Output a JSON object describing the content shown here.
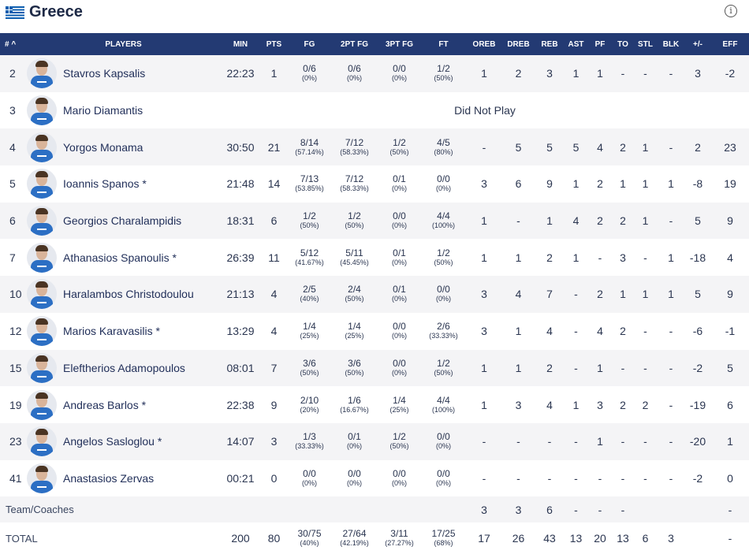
{
  "header": {
    "team_name": "Greece",
    "info_icon": "info-icon",
    "flag_icon": "greece-flag-icon"
  },
  "columns": [
    "# ^",
    "PLAYERS",
    "MIN",
    "PTS",
    "FG",
    "2PT FG",
    "3PT FG",
    "FT",
    "OREB",
    "DREB",
    "REB",
    "AST",
    "PF",
    "TO",
    "STL",
    "BLK",
    "+/-",
    "EFF"
  ],
  "players": [
    {
      "num": "2",
      "name": "Stavros Kapsalis",
      "min": "22:23",
      "pts": "1",
      "fg": "0/6",
      "fg_pct": "(0%)",
      "fg2": "0/6",
      "fg2_pct": "(0%)",
      "fg3": "0/0",
      "fg3_pct": "(0%)",
      "ft": "1/2",
      "ft_pct": "(50%)",
      "oreb": "1",
      "dreb": "2",
      "reb": "3",
      "ast": "1",
      "pf": "1",
      "to": "-",
      "stl": "-",
      "blk": "-",
      "pm": "3",
      "eff": "-2"
    },
    {
      "num": "3",
      "name": "Mario Diamantis",
      "dnp": "Did Not Play"
    },
    {
      "num": "4",
      "name": "Yorgos Monama",
      "min": "30:50",
      "pts": "21",
      "fg": "8/14",
      "fg_pct": "(57.14%)",
      "fg2": "7/12",
      "fg2_pct": "(58.33%)",
      "fg3": "1/2",
      "fg3_pct": "(50%)",
      "ft": "4/5",
      "ft_pct": "(80%)",
      "oreb": "-",
      "dreb": "5",
      "reb": "5",
      "ast": "5",
      "pf": "4",
      "to": "2",
      "stl": "1",
      "blk": "-",
      "pm": "2",
      "eff": "23"
    },
    {
      "num": "5",
      "name": "Ioannis Spanos *",
      "min": "21:48",
      "pts": "14",
      "fg": "7/13",
      "fg_pct": "(53.85%)",
      "fg2": "7/12",
      "fg2_pct": "(58.33%)",
      "fg3": "0/1",
      "fg3_pct": "(0%)",
      "ft": "0/0",
      "ft_pct": "(0%)",
      "oreb": "3",
      "dreb": "6",
      "reb": "9",
      "ast": "1",
      "pf": "2",
      "to": "1",
      "stl": "1",
      "blk": "1",
      "pm": "-8",
      "eff": "19"
    },
    {
      "num": "6",
      "name": "Georgios Charalampidis",
      "min": "18:31",
      "pts": "6",
      "fg": "1/2",
      "fg_pct": "(50%)",
      "fg2": "1/2",
      "fg2_pct": "(50%)",
      "fg3": "0/0",
      "fg3_pct": "(0%)",
      "ft": "4/4",
      "ft_pct": "(100%)",
      "oreb": "1",
      "dreb": "-",
      "reb": "1",
      "ast": "4",
      "pf": "2",
      "to": "2",
      "stl": "1",
      "blk": "-",
      "pm": "5",
      "eff": "9"
    },
    {
      "num": "7",
      "name": "Athanasios Spanoulis *",
      "min": "26:39",
      "pts": "11",
      "fg": "5/12",
      "fg_pct": "(41.67%)",
      "fg2": "5/11",
      "fg2_pct": "(45.45%)",
      "fg3": "0/1",
      "fg3_pct": "(0%)",
      "ft": "1/2",
      "ft_pct": "(50%)",
      "oreb": "1",
      "dreb": "1",
      "reb": "2",
      "ast": "1",
      "pf": "-",
      "to": "3",
      "stl": "-",
      "blk": "1",
      "pm": "-18",
      "eff": "4"
    },
    {
      "num": "10",
      "name": "Haralambos Christodoulou",
      "min": "21:13",
      "pts": "4",
      "fg": "2/5",
      "fg_pct": "(40%)",
      "fg2": "2/4",
      "fg2_pct": "(50%)",
      "fg3": "0/1",
      "fg3_pct": "(0%)",
      "ft": "0/0",
      "ft_pct": "(0%)",
      "oreb": "3",
      "dreb": "4",
      "reb": "7",
      "ast": "-",
      "pf": "2",
      "to": "1",
      "stl": "1",
      "blk": "1",
      "pm": "5",
      "eff": "9"
    },
    {
      "num": "12",
      "name": "Marios Karavasilis *",
      "min": "13:29",
      "pts": "4",
      "fg": "1/4",
      "fg_pct": "(25%)",
      "fg2": "1/4",
      "fg2_pct": "(25%)",
      "fg3": "0/0",
      "fg3_pct": "(0%)",
      "ft": "2/6",
      "ft_pct": "(33.33%)",
      "oreb": "3",
      "dreb": "1",
      "reb": "4",
      "ast": "-",
      "pf": "4",
      "to": "2",
      "stl": "-",
      "blk": "-",
      "pm": "-6",
      "eff": "-1"
    },
    {
      "num": "15",
      "name": "Eleftherios Adamopoulos",
      "min": "08:01",
      "pts": "7",
      "fg": "3/6",
      "fg_pct": "(50%)",
      "fg2": "3/6",
      "fg2_pct": "(50%)",
      "fg3": "0/0",
      "fg3_pct": "(0%)",
      "ft": "1/2",
      "ft_pct": "(50%)",
      "oreb": "1",
      "dreb": "1",
      "reb": "2",
      "ast": "-",
      "pf": "1",
      "to": "-",
      "stl": "-",
      "blk": "-",
      "pm": "-2",
      "eff": "5"
    },
    {
      "num": "19",
      "name": "Andreas Barlos *",
      "min": "22:38",
      "pts": "9",
      "fg": "2/10",
      "fg_pct": "(20%)",
      "fg2": "1/6",
      "fg2_pct": "(16.67%)",
      "fg3": "1/4",
      "fg3_pct": "(25%)",
      "ft": "4/4",
      "ft_pct": "(100%)",
      "oreb": "1",
      "dreb": "3",
      "reb": "4",
      "ast": "1",
      "pf": "3",
      "to": "2",
      "stl": "2",
      "blk": "-",
      "pm": "-19",
      "eff": "6"
    },
    {
      "num": "23",
      "name": "Angelos Sasloglou *",
      "min": "14:07",
      "pts": "3",
      "fg": "1/3",
      "fg_pct": "(33.33%)",
      "fg2": "0/1",
      "fg2_pct": "(0%)",
      "fg3": "1/2",
      "fg3_pct": "(50%)",
      "ft": "0/0",
      "ft_pct": "(0%)",
      "oreb": "-",
      "dreb": "-",
      "reb": "-",
      "ast": "-",
      "pf": "1",
      "to": "-",
      "stl": "-",
      "blk": "-",
      "pm": "-20",
      "eff": "1"
    },
    {
      "num": "41",
      "name": "Anastasios Zervas",
      "min": "00:21",
      "pts": "0",
      "fg": "0/0",
      "fg_pct": "(0%)",
      "fg2": "0/0",
      "fg2_pct": "(0%)",
      "fg3": "0/0",
      "fg3_pct": "(0%)",
      "ft": "0/0",
      "ft_pct": "(0%)",
      "oreb": "-",
      "dreb": "-",
      "reb": "-",
      "ast": "-",
      "pf": "-",
      "to": "-",
      "stl": "-",
      "blk": "-",
      "pm": "-2",
      "eff": "0"
    }
  ],
  "team_coaches": {
    "label": "Team/Coaches",
    "oreb": "3",
    "dreb": "3",
    "reb": "6",
    "ast": "-",
    "pf": "-",
    "to": "-",
    "stl": "",
    "blk": "",
    "pm": "",
    "eff": "-"
  },
  "total": {
    "label": "TOTAL",
    "min": "200",
    "pts": "80",
    "fg": "30/75",
    "fg_pct": "(40%)",
    "fg2": "27/64",
    "fg2_pct": "(42.19%)",
    "fg3": "3/11",
    "fg3_pct": "(27.27%)",
    "ft": "17/25",
    "ft_pct": "(68%)",
    "oreb": "17",
    "dreb": "26",
    "reb": "43",
    "ast": "13",
    "pf": "20",
    "to": "13",
    "stl": "6",
    "blk": "3",
    "pm": "",
    "eff": "-"
  }
}
